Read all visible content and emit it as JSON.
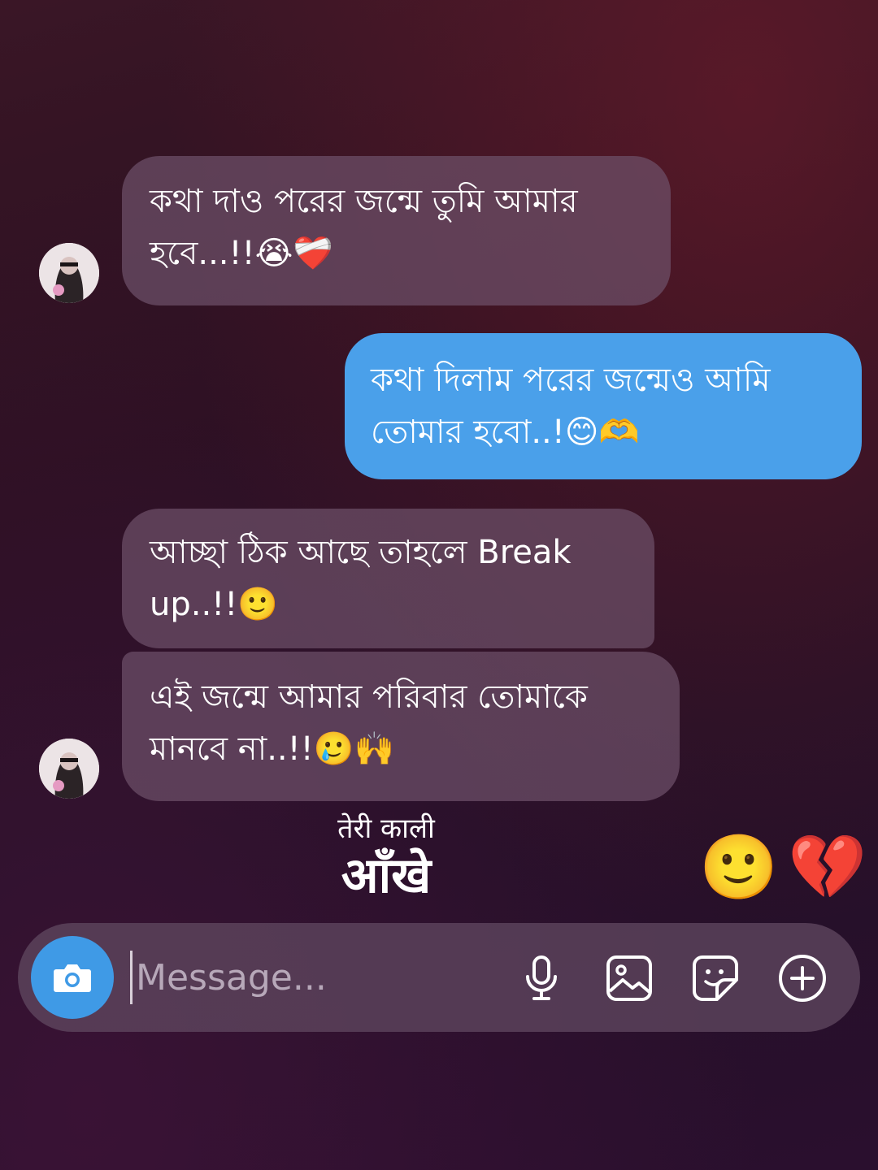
{
  "messages": [
    {
      "sender": "them",
      "text": "কথা দাও পরের জন্মে তুমি আমার\nহবে...!!😭❤️‍🩹"
    },
    {
      "sender": "me",
      "text": "কথা দিলাম পরের জন্মেও আমি\nতোমার হবো..!😊🫶"
    },
    {
      "sender": "them",
      "text": "আচ্ছা ঠিক আছে তাহলে Break\nup..!!🙂"
    },
    {
      "sender": "them",
      "text": "এই জন্মে আমার পরিবার তোমাকে\nমানবে না..!!🥲🙌"
    }
  ],
  "caption": {
    "line1": "तेरी काली",
    "line2": "आँखे"
  },
  "reactions": [
    "🙂",
    "💔"
  ],
  "composer": {
    "placeholder": "Message..."
  },
  "icons": {
    "camera": "camera-icon",
    "mic": "microphone-icon",
    "gallery": "gallery-icon",
    "sticker": "sticker-icon",
    "plus": "plus-circle-icon"
  },
  "colors": {
    "outgoing_bubble": "#4aa0ea",
    "camera_button": "#3f9ae6"
  }
}
